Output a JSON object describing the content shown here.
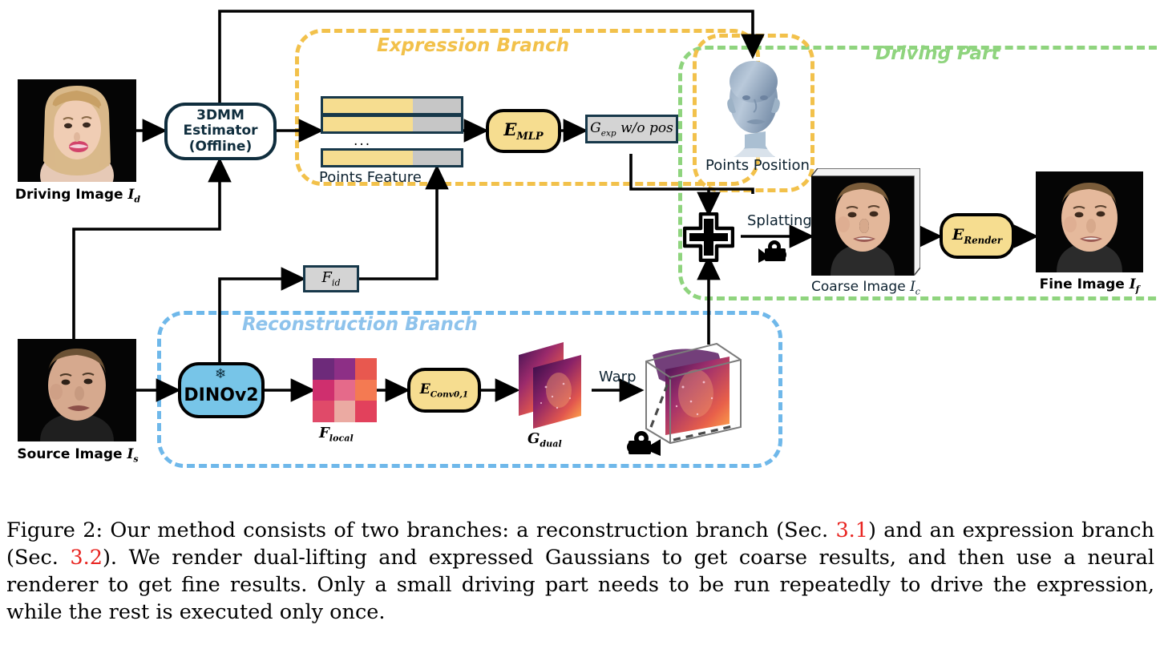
{
  "figure": {
    "branches": [
      {
        "key": "expression",
        "title": "Expression Branch",
        "color": "#f2c14b"
      },
      {
        "key": "driving",
        "title": "Driving Part",
        "color": "#8fd47e"
      },
      {
        "key": "reconstruction",
        "title": "Reconstruction Branch",
        "color": "#8ec3ec"
      }
    ],
    "nodes": {
      "estimator": {
        "line1": "3DMM",
        "line2": "Estimator",
        "line3": "(Offline)"
      },
      "emlp": {
        "base": "E",
        "sub": "MLP"
      },
      "gexp": {
        "text": "G",
        "sub": "exp",
        "rest": " w/o pos"
      },
      "dinov2": {
        "label": "DINOv2",
        "icon": "snowflake-icon",
        "glyph": "❄"
      },
      "econv": {
        "base": "E",
        "sub": "Conv0,1"
      },
      "erender": {
        "base": "E",
        "sub": "Render"
      },
      "fid": {
        "base": "F",
        "sub": "id"
      },
      "merge": {
        "icon": "plus-merge-icon"
      }
    },
    "labels": {
      "points_feature": "Points Feature",
      "points_feature_ellipsis": "...",
      "points_position": "Points Position",
      "splatting": "Splatting",
      "warp": "Warp",
      "f_local_base": "F",
      "f_local_sub": "local",
      "g_dual_base": "G",
      "g_dual_sub": "dual",
      "camera_icon": "movie-camera-icon"
    },
    "images": [
      {
        "key": "driving",
        "caption_main": "Driving Image ",
        "caption_math": "I",
        "caption_sub": "d",
        "bold": true
      },
      {
        "key": "source",
        "caption_main": "Source Image ",
        "caption_math": "I",
        "caption_sub": "s",
        "bold": true
      },
      {
        "key": "coarse",
        "caption_main": "Coarse Image ",
        "caption_math": "I",
        "caption_sub": "c",
        "bold": false
      },
      {
        "key": "fine",
        "caption_main": "Fine Image ",
        "caption_math": "I",
        "caption_sub": "f",
        "bold": true
      }
    ],
    "colors": {
      "yellow_fill": "#f6dd90",
      "yellow_dash": "#f2c14b",
      "green_dash": "#8fd47e",
      "blue_dash": "#6fb8ea",
      "blue_fill": "#77c5e8",
      "gray_fill": "#d4d4d4",
      "navy_stroke": "#17384a",
      "arrow": "#000000"
    }
  },
  "caption": {
    "number": "Figure 2:",
    "part1": "  Our method consists of two branches: a reconstruction branch (Sec. ",
    "ref1": "3.1",
    "part2": ") and an expression branch (Sec. ",
    "ref2": "3.2",
    "part3": "). We render dual-lifting and expressed Gaussians to get coarse results, and then use a neural renderer to get fine results. Only a small driving part needs to be run repeatedly to drive the expression, while the rest is executed only once."
  }
}
